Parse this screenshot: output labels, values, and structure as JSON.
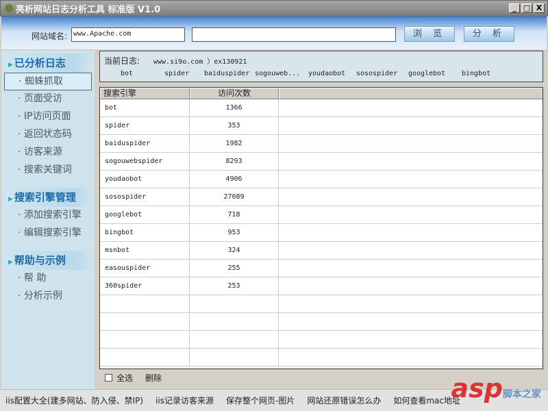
{
  "window": {
    "title": "亮析网站日志分析工具 标准版 V1.0",
    "controls": [
      "_",
      "□",
      "X"
    ]
  },
  "toolbar": {
    "domain_label": "网站域名:",
    "domain_value": "www.Apache.com",
    "path_value": "",
    "browse": "浏 览",
    "analyze": "分 析"
  },
  "sidebar": {
    "sections": [
      {
        "title": "已分析日志",
        "items": [
          "· 蜘蛛抓取",
          "· 页面受访",
          "· IP访问页面",
          "· 返回状态码",
          "· 访客来源",
          "· 搜索关键词"
        ]
      },
      {
        "title": "搜索引擎管理",
        "items": [
          "· 添加搜索引擎",
          "· 编辑搜索引擎"
        ]
      },
      {
        "title": "帮助与示例",
        "items": [
          "· 帮 助",
          "· 分析示例"
        ]
      }
    ]
  },
  "log": {
    "label": "当前日志:",
    "path": "www.si9o.com 〉ex130921",
    "engines": [
      "bot",
      "spider",
      "baiduspider",
      "sogouweb...",
      "youdaobot",
      "sosospider",
      "googlebot",
      "bingbot"
    ]
  },
  "table": {
    "headers": [
      "搜索引擎",
      "访问次数",
      ""
    ],
    "rows": [
      [
        "bot",
        "1366"
      ],
      [
        "spider",
        "353"
      ],
      [
        "baiduspider",
        "1982"
      ],
      [
        "sogouwebspider",
        "8293"
      ],
      [
        "youdaobot",
        "4906"
      ],
      [
        "sosospider",
        "27089"
      ],
      [
        "googlebot",
        "718"
      ],
      [
        "bingbot",
        "953"
      ],
      [
        "msnbot",
        "324"
      ],
      [
        "easouspider",
        "255"
      ],
      [
        "360spider",
        "253"
      ],
      [
        "",
        ""
      ],
      [
        "",
        ""
      ],
      [
        "",
        ""
      ],
      [
        "",
        ""
      ]
    ]
  },
  "footer": {
    "select_all": "全选",
    "delete": "删除"
  },
  "status_links": [
    "iis配置大全(建多网站、防入侵、禁IP)",
    "iis记录访客来源",
    "保存整个网页-图片",
    "网站还原错误怎么办",
    "如何查看mac地址"
  ],
  "watermark": {
    "brand": "asp",
    "sub": "脚本之家"
  }
}
